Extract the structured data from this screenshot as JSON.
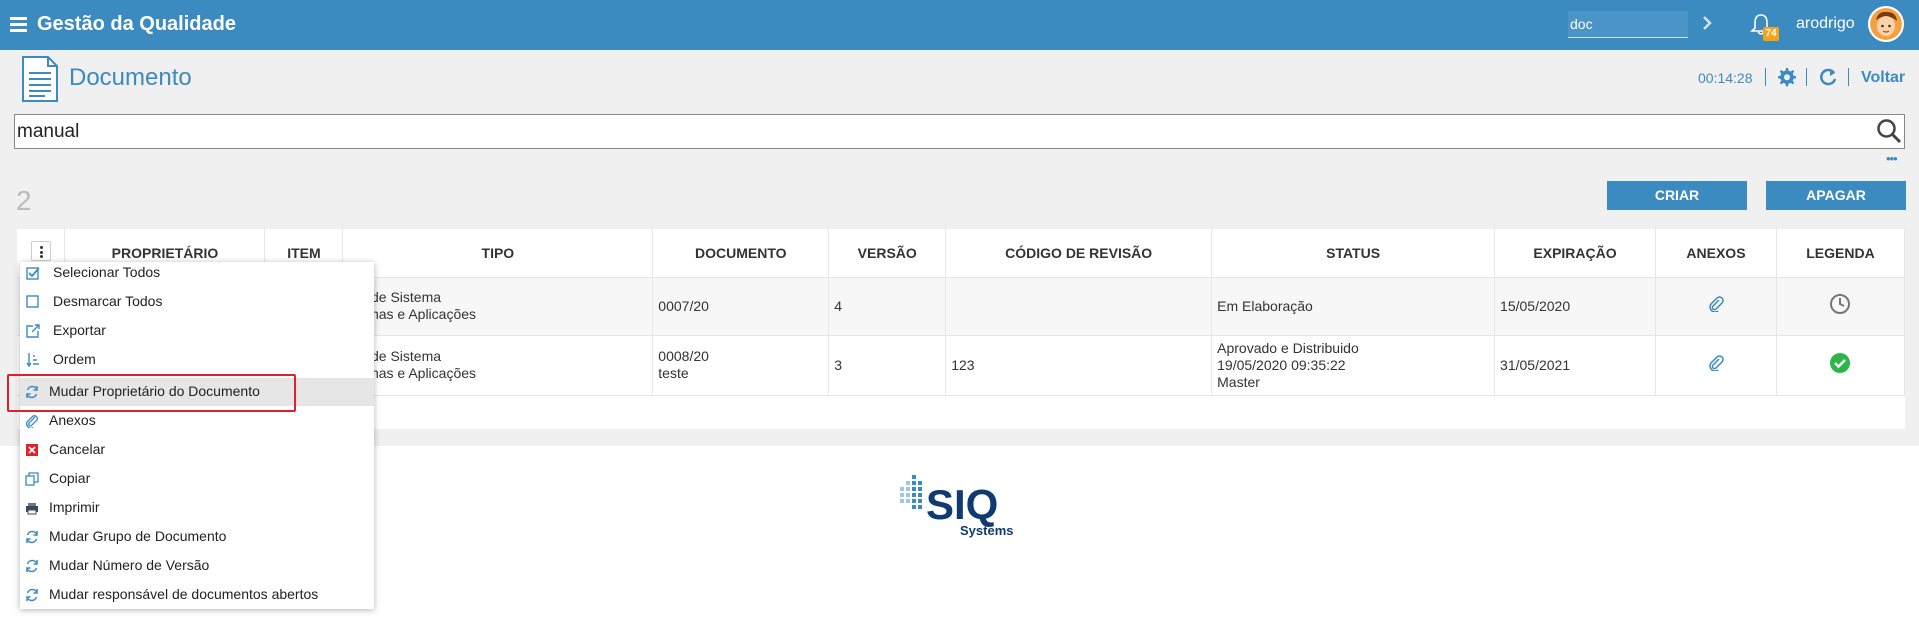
{
  "app": {
    "title": "Gestão da Qualidade"
  },
  "topbar": {
    "search_value": "doc",
    "notification_count": "74",
    "username": "arodrigo"
  },
  "page": {
    "title": "Documento",
    "timer": "00:14:28",
    "back_label": "Voltar"
  },
  "search": {
    "value": "manual",
    "more": "•••"
  },
  "results": {
    "count": "2"
  },
  "actions": {
    "create": "CRIAR",
    "delete": "APAGAR"
  },
  "table": {
    "headers": [
      "PROPRIETÁRIO",
      "ITEM",
      "TIPO",
      "DOCUMENTO",
      "VERSÃO",
      "CÓDIGO DE REVISÃO",
      "STATUS",
      "EXPIRAÇÃO",
      "ANEXOS",
      "LEGENDA"
    ],
    "rows": [
      {
        "tipo_line1": "ual de Sistema",
        "tipo_line2": "stemas e Aplicações",
        "documento_line1": "0007/20",
        "documento_line2": "",
        "versao": "4",
        "codigo_revisao": "",
        "status_line1": "Em Elaboração",
        "status_line2": "",
        "status_line3": "",
        "expiracao": "15/05/2020",
        "legenda_icon": "clock-icon"
      },
      {
        "tipo_line1": "ual de Sistema",
        "tipo_line2": "stemas e Aplicações",
        "documento_line1": "0008/20",
        "documento_line2": "teste",
        "versao": "3",
        "codigo_revisao": "123",
        "status_line1": "Aprovado e Distribuido",
        "status_line2": "19/05/2020 09:35:22",
        "status_line3": "Master",
        "expiracao": "31/05/2021",
        "legenda_icon": "check-circle-icon"
      }
    ]
  },
  "menu": {
    "items": [
      {
        "label": "Selecionar Todos",
        "icon": "checkbox-checked-icon"
      },
      {
        "label": "Desmarcar Todos",
        "icon": "checkbox-empty-icon"
      },
      {
        "label": "Exportar",
        "icon": "export-icon"
      },
      {
        "label": "Ordem",
        "icon": "sort-icon"
      },
      {
        "label": "Mudar Proprietário do Documento",
        "icon": "refresh-icon"
      },
      {
        "label": "Anexos",
        "icon": "paperclip-icon"
      },
      {
        "label": "Cancelar",
        "icon": "cancel-icon"
      },
      {
        "label": "Copiar",
        "icon": "copy-icon"
      },
      {
        "label": "Imprimir",
        "icon": "printer-icon"
      },
      {
        "label": "Mudar Grupo de Documento",
        "icon": "refresh-icon"
      },
      {
        "label": "Mudar Número de Versão",
        "icon": "refresh-icon"
      },
      {
        "label": "Mudar responsável de documentos abertos",
        "icon": "refresh-icon"
      }
    ]
  },
  "footer": {
    "logo_text": "SIQ",
    "logo_subtext": "Systems"
  },
  "colors": {
    "primary": "#3b8ac0",
    "badge": "#f7a21b",
    "highlight": "#e0202a",
    "success": "#2eb54a"
  }
}
